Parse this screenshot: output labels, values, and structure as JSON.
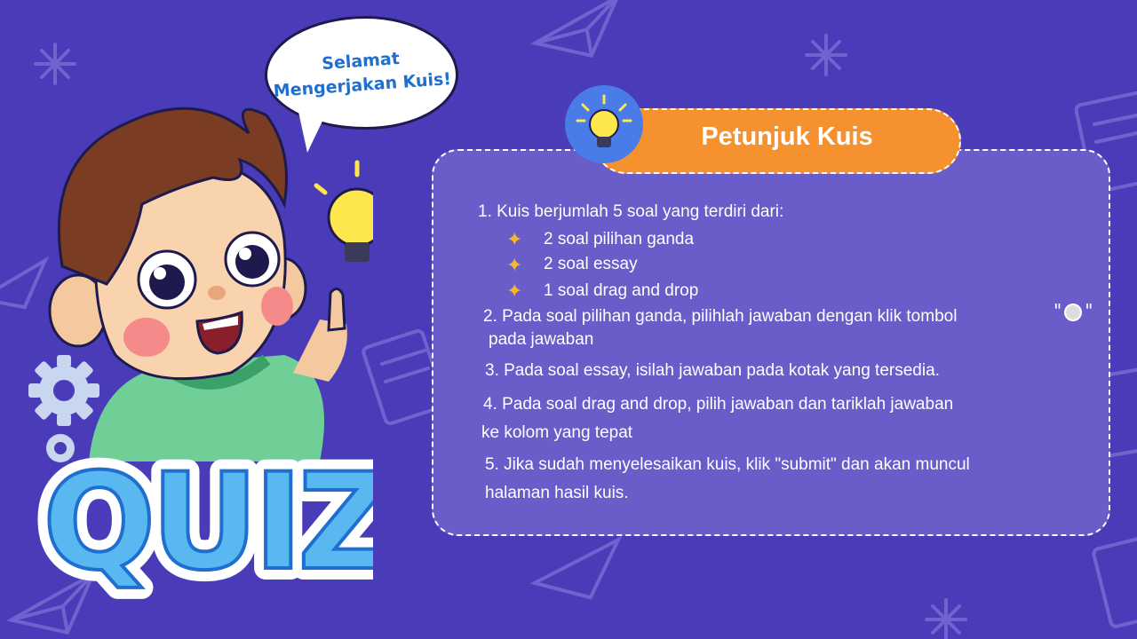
{
  "bubble": {
    "line1": "Selamat",
    "line2": "Mengerjakan Kuis!"
  },
  "title": "Petunjuk Kuis",
  "instructions": {
    "item1": "1. Kuis berjumlah 5 soal yang terdiri dari:",
    "sub_items": [
      "2 soal pilihan ganda",
      "2 soal essay",
      "1 soal drag and drop"
    ],
    "item2_line1": "2. Pada soal pilihan ganda, pilihlah jawaban dengan klik tombol",
    "item2_line2": "pada jawaban",
    "item3": "3. Pada soal essay, isilah jawaban pada kotak yang tersedia.",
    "item4_line1": "4. Pada soal drag and drop, pilih jawaban dan tariklah jawaban",
    "item4_line2": "ke kolom yang tepat",
    "item5_line1": "5. Jika sudah menyelesaikan kuis, klik \"submit\" dan akan muncul",
    "item5_line2": "halaman hasil kuis."
  },
  "logo_text": "QUIZ",
  "colors": {
    "background": "#4a3bb8",
    "panel": "#6a5cc9",
    "title_pill": "#f5922f",
    "bubble_text": "#1e6fd0",
    "star": "#f5b82a",
    "quiz_logo": "#5ab8f0"
  },
  "icons": [
    "lightbulb-icon",
    "sparkle-icon",
    "gear-icon",
    "radio-button-icon",
    "paper-plane-icon",
    "asterisk-icon"
  ]
}
